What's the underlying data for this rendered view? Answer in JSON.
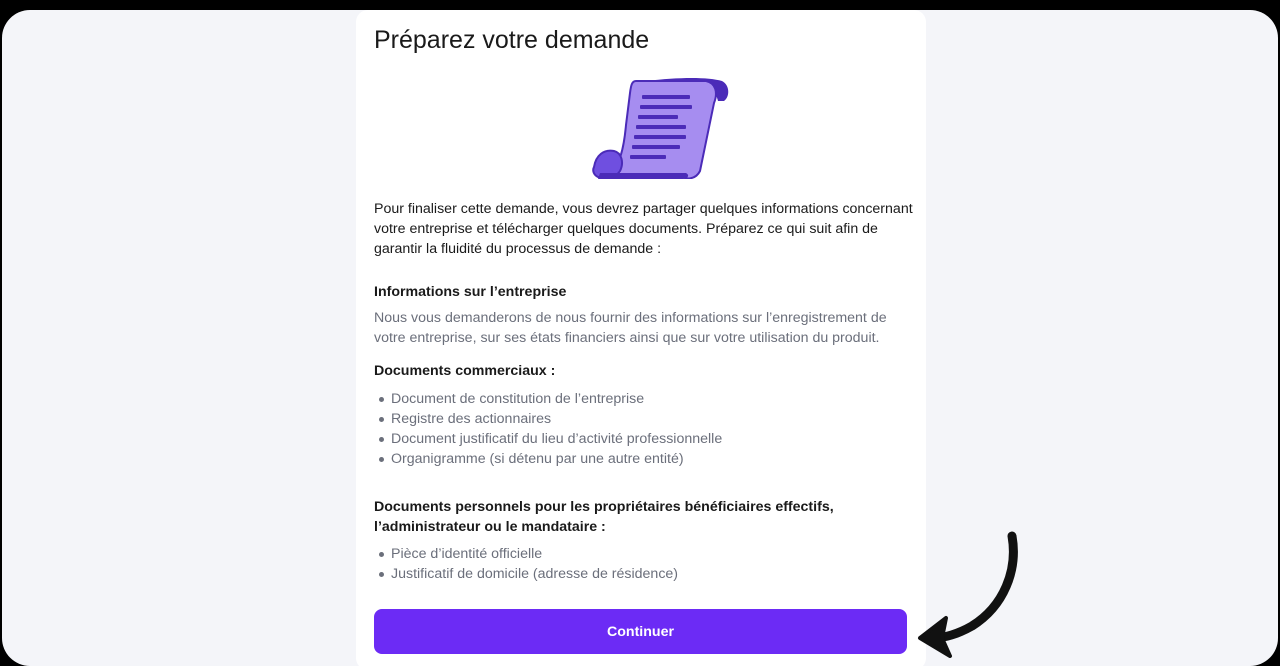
{
  "colors": {
    "accent": "#6c2bf5",
    "heading": "#1a1a1a",
    "muted": "#6b6f7b",
    "illustration_light": "#a68df0",
    "illustration_dark": "#4b2bb8"
  },
  "page": {
    "title": "Préparez votre demande",
    "illustration_icon": "scroll-document-icon",
    "intro": "Pour finaliser cette demande, vous devrez partager quelques informations concernant votre entreprise et télécharger quelques documents. Préparez ce qui suit afin de garantir la fluidité du processus de demande :"
  },
  "company_info": {
    "heading": "Informations sur l’entreprise",
    "description": "Nous vous demanderons de nous fournir des informations sur l’enregistrement de votre entreprise, sur ses états financiers ainsi que sur votre utilisation du produit."
  },
  "business_docs": {
    "heading": "Documents commerciaux :",
    "items": [
      "Document de constitution de l’entreprise",
      "Registre des actionnaires",
      "Document justificatif du lieu d’activité professionnelle",
      "Organigramme (si détenu par une autre entité)"
    ]
  },
  "personal_docs": {
    "heading": "Documents personnels pour les propriétaires bénéficiaires effectifs, l’administrateur ou le mandataire :",
    "items": [
      "Pièce d’identité officielle",
      "Justificatif de domicile (adresse de résidence)"
    ]
  },
  "actions": {
    "continue_label": "Continuer"
  },
  "annotation": {
    "arrow_icon": "curved-arrow-icon"
  }
}
